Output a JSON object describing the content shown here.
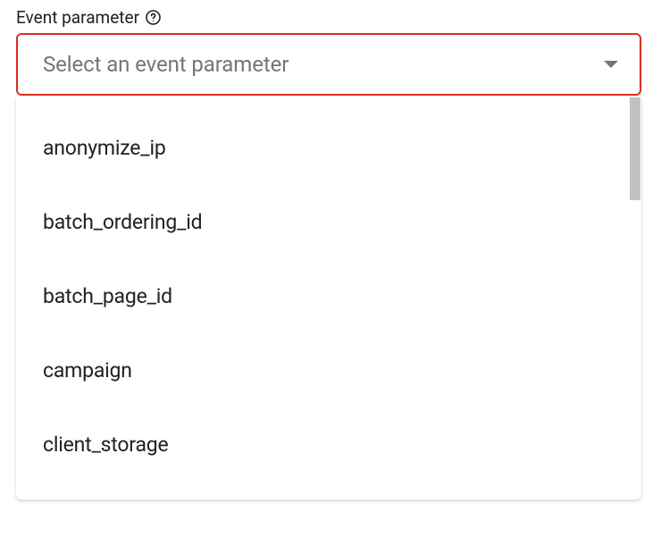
{
  "label": "Event parameter",
  "placeholder": "Select an event parameter",
  "options": [
    "anonymize_ip",
    "batch_ordering_id",
    "batch_page_id",
    "campaign",
    "client_storage"
  ]
}
